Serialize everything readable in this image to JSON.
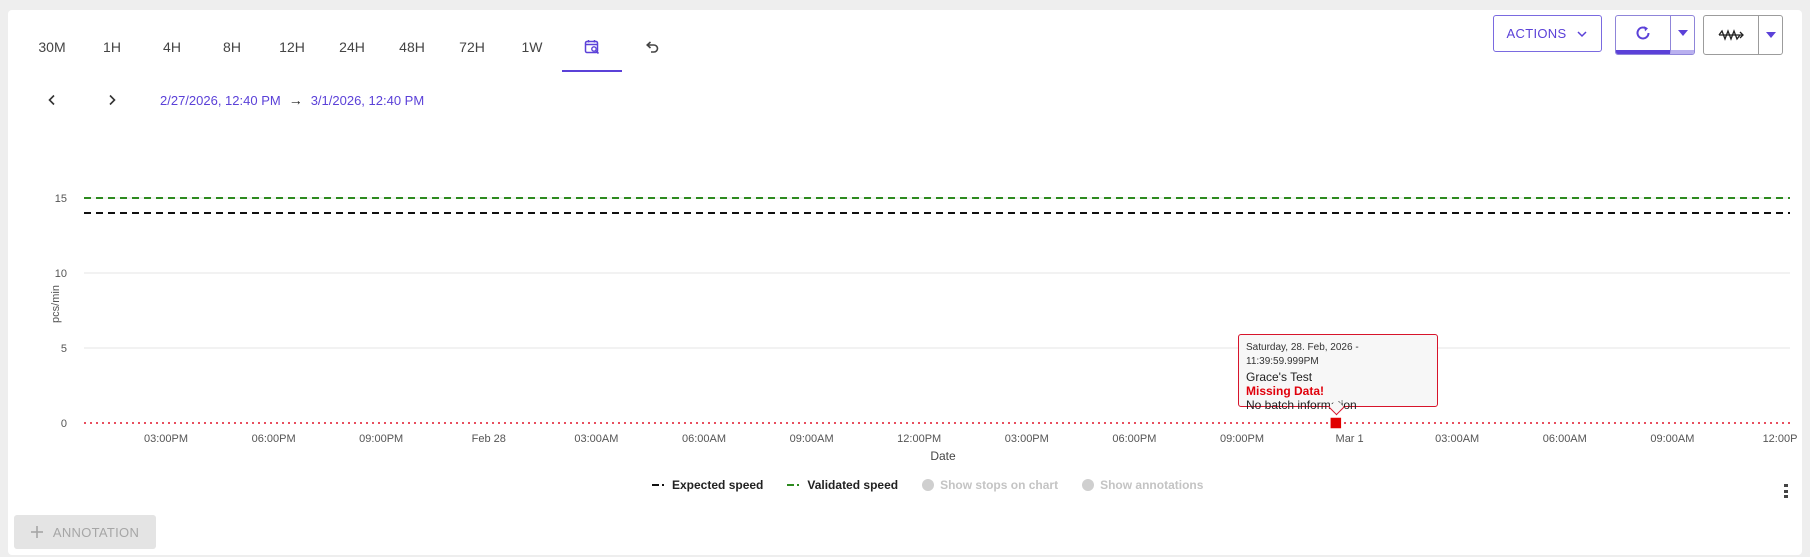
{
  "range_tabs": [
    "30M",
    "1H",
    "4H",
    "8H",
    "12H",
    "24H",
    "48H",
    "72H",
    "1W"
  ],
  "date_range": {
    "start": "2/27/2026, 12:40 PM",
    "arrow": "→",
    "end": "3/1/2026, 12:40 PM"
  },
  "toolbar": {
    "actions_label": "ACTIONS"
  },
  "chart_data": {
    "type": "line",
    "ylabel": "pcs/min",
    "xlabel": "Date",
    "ylim": [
      0,
      17
    ],
    "yticks": [
      0,
      5,
      10,
      15
    ],
    "xticks": [
      "03:00PM",
      "06:00PM",
      "09:00PM",
      "Feb 28",
      "03:00AM",
      "06:00AM",
      "09:00AM",
      "12:00PM",
      "03:00PM",
      "06:00PM",
      "09:00PM",
      "Mar 1",
      "03:00AM",
      "06:00AM",
      "09:00AM",
      "12:00P"
    ],
    "series": [
      {
        "name": "Expected speed",
        "style": "dashed",
        "color": "#111111",
        "values": [
          14,
          14
        ]
      },
      {
        "name": "Validated speed",
        "style": "dashed",
        "color": "#2d8a1f",
        "values": [
          15,
          15
        ]
      },
      {
        "name": "",
        "style": "dotted",
        "color": "#e0142a",
        "values": [
          0,
          0
        ]
      }
    ],
    "marker": {
      "x_tick_position": 10.9,
      "y": 0,
      "color": "#e00000"
    },
    "tooltip": {
      "date": "Saturday, 28. Feb, 2026 - 11:39:59.999PM",
      "name": "Grace's Test",
      "status": "Missing Data!",
      "info": "No batch information"
    },
    "grid": true
  },
  "legend": {
    "expected": "Expected speed",
    "validated": "Validated speed",
    "stops": "Show stops on chart",
    "annotations": "Show annotations"
  },
  "annotation_button": {
    "label": "ANNOTATION"
  },
  "colors": {
    "accent": "#5b41d8",
    "missing": "#e0000b"
  }
}
